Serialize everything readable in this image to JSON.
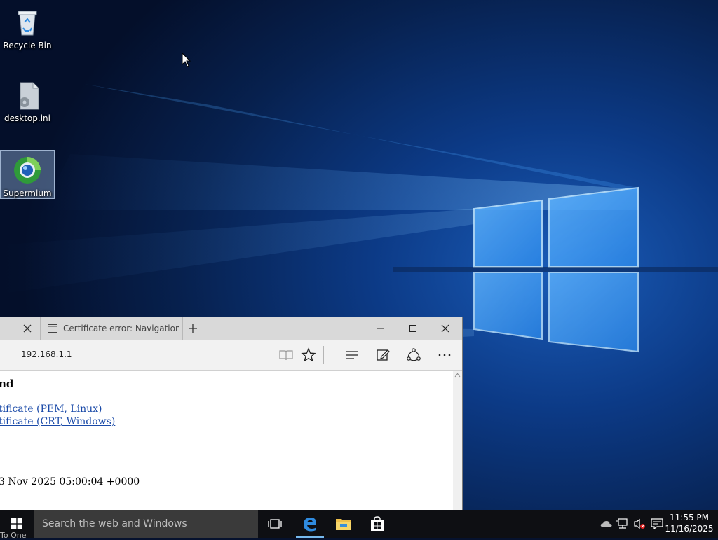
{
  "desktop": {
    "icons": [
      {
        "label": "Recycle Bin",
        "icon": "recycle-bin-icon"
      },
      {
        "label": "desktop.ini",
        "icon": "settings-file-icon"
      },
      {
        "label": "Supermium",
        "icon": "supermium-browser-icon"
      }
    ]
  },
  "browser": {
    "tab_title": "Certificate error: Navigation l",
    "address": "192.168.1.1",
    "content": {
      "heading": "nd",
      "links": [
        "tificate (PEM, Linux)",
        "tificate (CRT, Windows)"
      ],
      "date_line": "3 Nov 2025 05:00:04 +0000"
    }
  },
  "taskbar": {
    "search_placeholder": "Search the web and Windows",
    "clock_time": "11:55 PM",
    "clock_date": "11/16/2025",
    "ghost_text": "To One"
  },
  "colors": {
    "accent": "#76b9ed",
    "link": "#1a4aa8",
    "taskbar": "#0e0f13"
  }
}
